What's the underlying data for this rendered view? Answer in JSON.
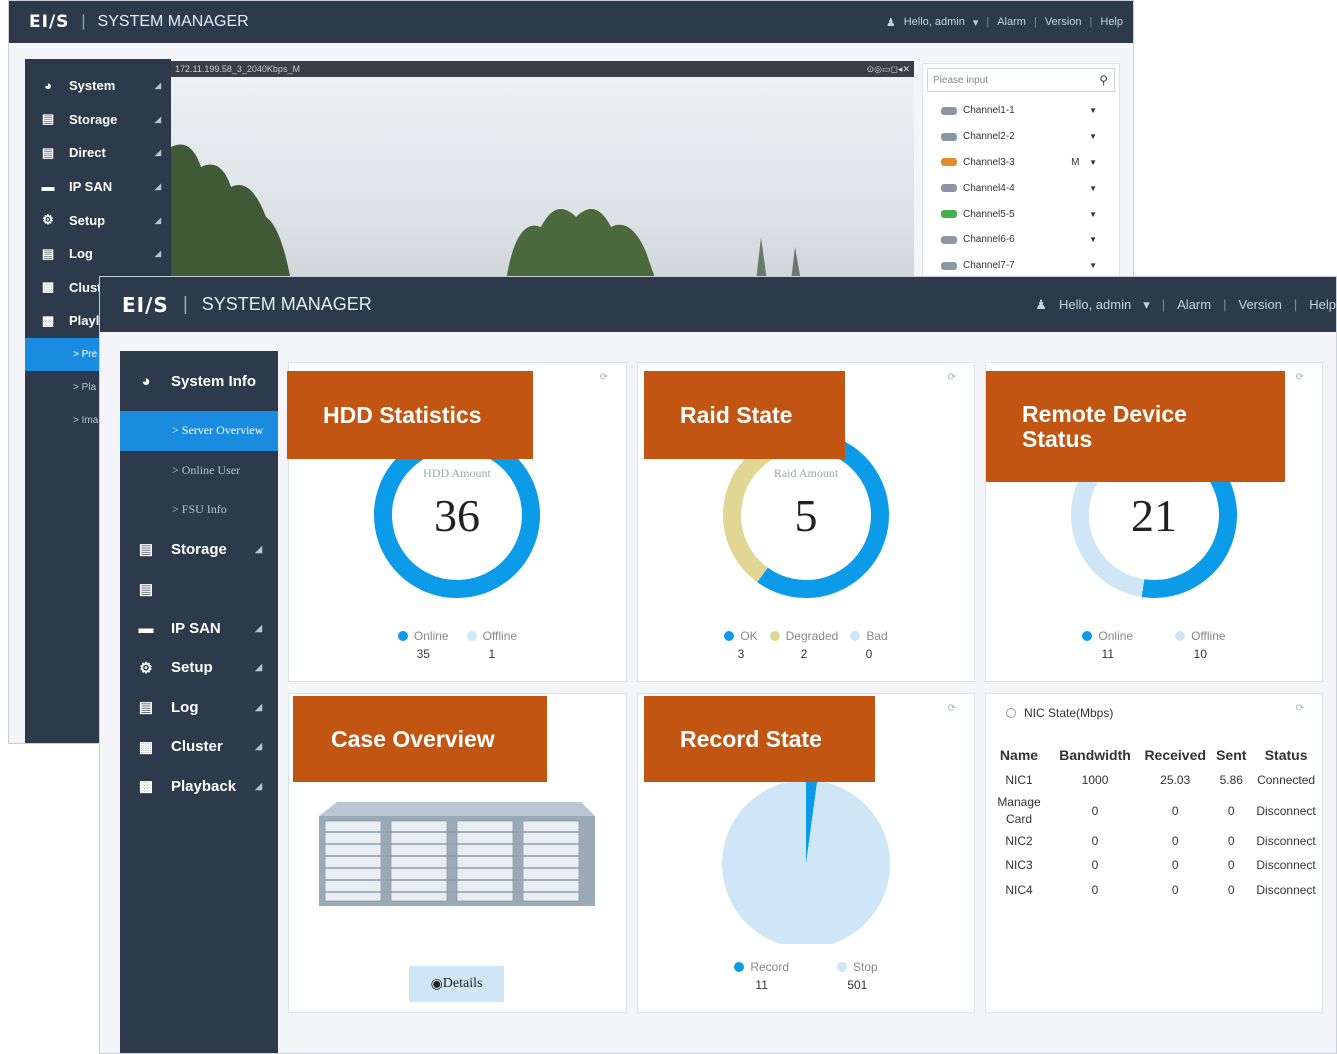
{
  "header": {
    "logo": "EI/S",
    "separator": "|",
    "title": "SYSTEM MANAGER",
    "user": "Hello, admin",
    "alarm": "Alarm",
    "version": "Version",
    "help": "Help"
  },
  "back_window": {
    "sidebar": [
      {
        "label": "System",
        "icon": "pie-chart-icon"
      },
      {
        "label": "Storage",
        "icon": "floppy-icon"
      },
      {
        "label": "Direct",
        "icon": "direct-icon"
      },
      {
        "label": "IP SAN",
        "icon": "server-icon"
      },
      {
        "label": "Setup",
        "icon": "gear-icon"
      },
      {
        "label": "Log",
        "icon": "document-icon"
      },
      {
        "label": "Clust",
        "icon": "cluster-icon"
      },
      {
        "label": "Playl",
        "icon": "playback-icon"
      }
    ],
    "sub_items": [
      "> Pre",
      "> Pla",
      "> Ima"
    ],
    "video_title": "172.11.199.58_3_2040Kbps_M",
    "video_controls": "⊙◎▭◻◂✕",
    "search_placeholder": "Please input",
    "channels": [
      {
        "name": "Channel1-1",
        "flag": "",
        "color": "#8a96a4"
      },
      {
        "name": "Channel2-2",
        "flag": "",
        "color": "#8a96a4"
      },
      {
        "name": "Channel3-3",
        "flag": "M",
        "color": "#e78a2c"
      },
      {
        "name": "Channel4-4",
        "flag": "",
        "color": "#8a96a4"
      },
      {
        "name": "Channel5-5",
        "flag": "",
        "color": "#43b04c"
      },
      {
        "name": "Channel6-6",
        "flag": "",
        "color": "#8a96a4"
      },
      {
        "name": "Channel7-7",
        "flag": "",
        "color": "#8a96a4"
      }
    ]
  },
  "sidebar": {
    "system_info": "System Info",
    "sub": [
      "> Server Overview",
      "> Online User",
      "> FSU Info"
    ],
    "items": [
      {
        "label": "Storage",
        "icon": "floppy-icon"
      },
      {
        "label": "",
        "icon": "direct-icon"
      },
      {
        "label": "IP SAN",
        "icon": "server-icon"
      },
      {
        "label": "Setup",
        "icon": "gear-icon"
      },
      {
        "label": "Log",
        "icon": "document-icon"
      },
      {
        "label": "Cluster",
        "icon": "cluster-icon"
      },
      {
        "label": "Playback",
        "icon": "playback-icon"
      }
    ]
  },
  "cards": {
    "hdd": {
      "badge": "HDD Statistics",
      "center_label": "HDD Amount",
      "center_value": "36",
      "legend": [
        {
          "label": "Online",
          "value": "35",
          "color": "#0c9be8"
        },
        {
          "label": "Offline",
          "value": "1",
          "color": "#cfe6f6"
        }
      ]
    },
    "raid": {
      "badge": "Raid State",
      "center_label": "Raid Amount",
      "center_value": "5",
      "legend": [
        {
          "label": "OK",
          "value": "3",
          "color": "#0c9be8"
        },
        {
          "label": "Degraded",
          "value": "2",
          "color": "#e2d694"
        },
        {
          "label": "Bad",
          "value": "0",
          "color": "#cfe6f6"
        }
      ]
    },
    "remote": {
      "badge_line1": "Remote Device",
      "badge_line2": "Status",
      "center_value": "21",
      "legend": [
        {
          "label": "Online",
          "value": "11",
          "color": "#0c9be8"
        },
        {
          "label": "Offline",
          "value": "10",
          "color": "#cfe6f6"
        }
      ]
    },
    "case": {
      "badge": "Case Overview",
      "details": "Details"
    },
    "record": {
      "badge": "Record State",
      "legend": [
        {
          "label": "Record",
          "value": "11",
          "color": "#0c9be8"
        },
        {
          "label": "Stop",
          "value": "501",
          "color": "#cfe6f6"
        }
      ]
    },
    "nic": {
      "title": "NIC State(Mbps)",
      "headers": [
        "Name",
        "Bandwidth",
        "Received",
        "Sent",
        "Status"
      ],
      "rows": [
        [
          "NIC1",
          "1000",
          "25.03",
          "5.86",
          "Connected"
        ],
        [
          "Manage Card",
          "0",
          "0",
          "0",
          "Disconnect"
        ],
        [
          "NIC2",
          "0",
          "0",
          "0",
          "Disconnect"
        ],
        [
          "NIC3",
          "0",
          "0",
          "0",
          "Disconnect"
        ],
        [
          "NIC4",
          "0",
          "0",
          "0",
          "Disconnect"
        ]
      ]
    }
  },
  "chart_data": [
    {
      "type": "pie",
      "title": "HDD Amount",
      "categories": [
        "Online",
        "Offline"
      ],
      "values": [
        35,
        1
      ]
    },
    {
      "type": "pie",
      "title": "Raid Amount",
      "categories": [
        "OK",
        "Degraded",
        "Bad"
      ],
      "values": [
        3,
        2,
        0
      ]
    },
    {
      "type": "pie",
      "categories": [
        "Online",
        "Offline"
      ],
      "values": [
        11,
        10
      ]
    },
    {
      "type": "pie",
      "categories": [
        "Record",
        "Stop"
      ],
      "values": [
        11,
        501
      ]
    }
  ]
}
